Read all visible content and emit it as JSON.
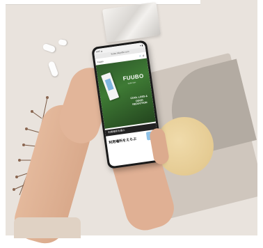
{
  "phone_screen": {
    "status_left": "8:05 ▲",
    "status_right": "● ▮",
    "url": "fuubo.tokyofbo.com",
    "nav_left": "Fuubo",
    "nav_right": "🛒 ☰",
    "brand": "FUUBO",
    "brand_sub": "fuubo labs",
    "tagline": "COOL LOSS & ODOR REDUCTION",
    "stripe_text": "利用場所を選ぶ",
    "heading": "利用場所をえらぶ"
  },
  "colors": {
    "background": "#e9e3dd",
    "hero_green": "#3e7a34"
  }
}
